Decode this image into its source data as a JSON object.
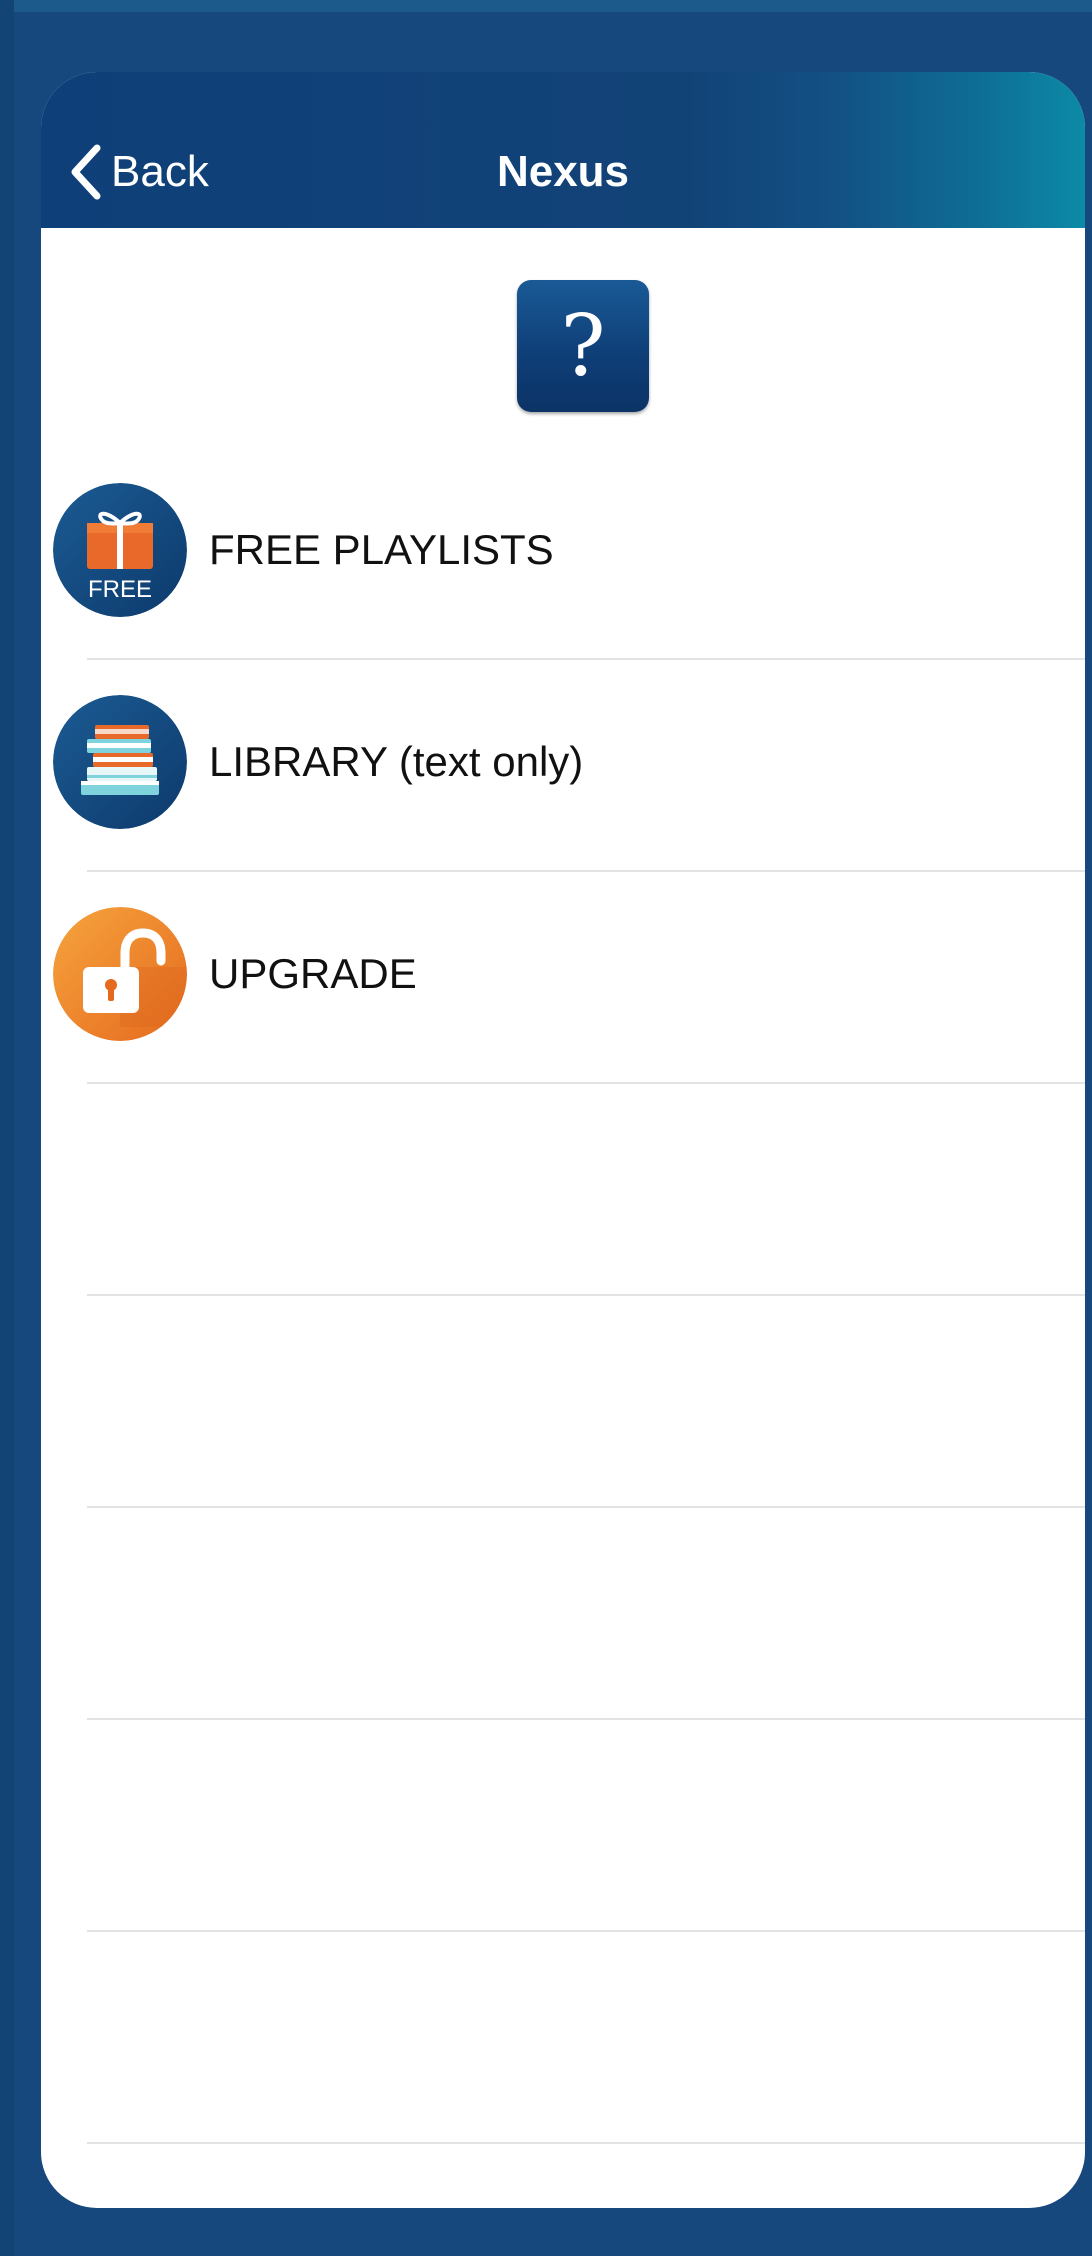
{
  "nav": {
    "back_label": "Back",
    "title": "Nexus"
  },
  "help": {
    "glyph": "?"
  },
  "menu": {
    "items": [
      {
        "label": "FREE PLAYLISTS",
        "icon": "free-gift-icon",
        "badge": "FREE"
      },
      {
        "label": "LIBRARY (text only)",
        "icon": "book-stack-icon"
      },
      {
        "label": "UPGRADE",
        "icon": "unlock-padlock-icon"
      }
    ],
    "empty_rows": 5
  },
  "colors": {
    "nav_bar": "#0f3f78",
    "accent_teal": "#0c8aa6",
    "page_background": "#16487e",
    "upgrade_orange": "#f08a2e"
  }
}
